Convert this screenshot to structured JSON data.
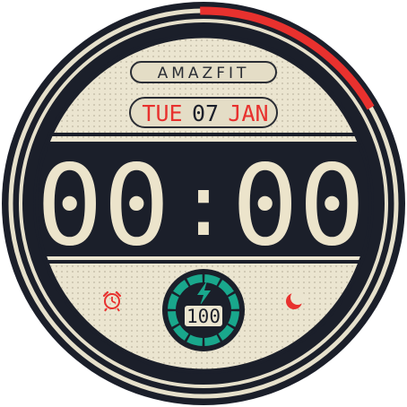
{
  "brand": "AMAZFIT",
  "date": {
    "weekday": "TUE",
    "day": "07",
    "month": "JAN"
  },
  "time": {
    "hours": "00",
    "minutes": "00",
    "separator": ":"
  },
  "battery": {
    "percent": "100",
    "level_fraction": 1.0
  },
  "progress_arc": {
    "fraction": 0.17
  },
  "icons": {
    "alarm": "alarm-clock-icon",
    "night": "moon-icon",
    "battery": "lightning-bolt-icon"
  },
  "colors": {
    "accent_red": "#e8312e",
    "dial": "#ebe5d0",
    "dark": "#1b1f2a",
    "digit": "#ece4cb",
    "battery_teal": "#19a78c"
  }
}
